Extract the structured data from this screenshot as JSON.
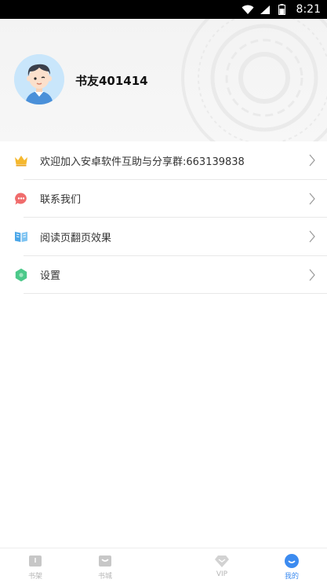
{
  "status_bar": {
    "time": "8:21"
  },
  "profile": {
    "username": "书友401414"
  },
  "menu": {
    "items": [
      {
        "label": "欢迎加入安卓软件互助与分享群:663139838",
        "icon": "crown-icon"
      },
      {
        "label": "联系我们",
        "icon": "chat-bubble-icon"
      },
      {
        "label": "阅读页翻页效果",
        "icon": "book-open-icon"
      },
      {
        "label": "设置",
        "icon": "hexagon-settings-icon"
      }
    ]
  },
  "tabs": [
    {
      "label": "书架",
      "icon": "bookshelf-icon",
      "active": false
    },
    {
      "label": "书城",
      "icon": "bookstore-icon",
      "active": false
    },
    {
      "label": "VIP",
      "icon": "diamond-icon",
      "active": false
    },
    {
      "label": "我的",
      "icon": "profile-smile-icon",
      "active": true
    }
  ],
  "colors": {
    "accent": "#3c8bf0",
    "crown": "#f5b82e",
    "chat": "#f06c6c",
    "book": "#4aa6e8",
    "settings": "#4cc98a"
  }
}
